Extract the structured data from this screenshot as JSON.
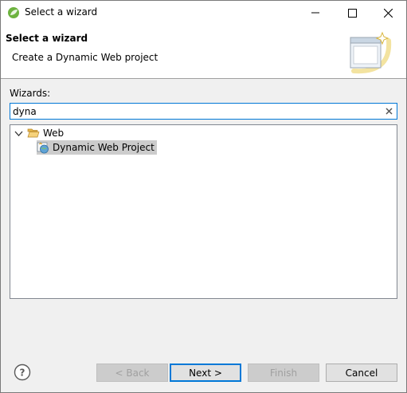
{
  "window": {
    "title": "Select a wizard"
  },
  "header": {
    "title": "Select a wizard",
    "description": "Create a Dynamic Web project"
  },
  "wizards_label": "Wizards:",
  "search": {
    "value": "dyna"
  },
  "tree": [
    {
      "label": "Web",
      "icon": "folder-open-icon",
      "expanded": true,
      "children": [
        {
          "label": "Dynamic Web Project",
          "icon": "dynamic-web-project-icon",
          "selected": true
        }
      ]
    }
  ],
  "buttons": {
    "back": "< Back",
    "next": "Next >",
    "finish": "Finish",
    "cancel": "Cancel"
  },
  "colors": {
    "focus": "#0078d7",
    "selection": "#cccccc"
  }
}
